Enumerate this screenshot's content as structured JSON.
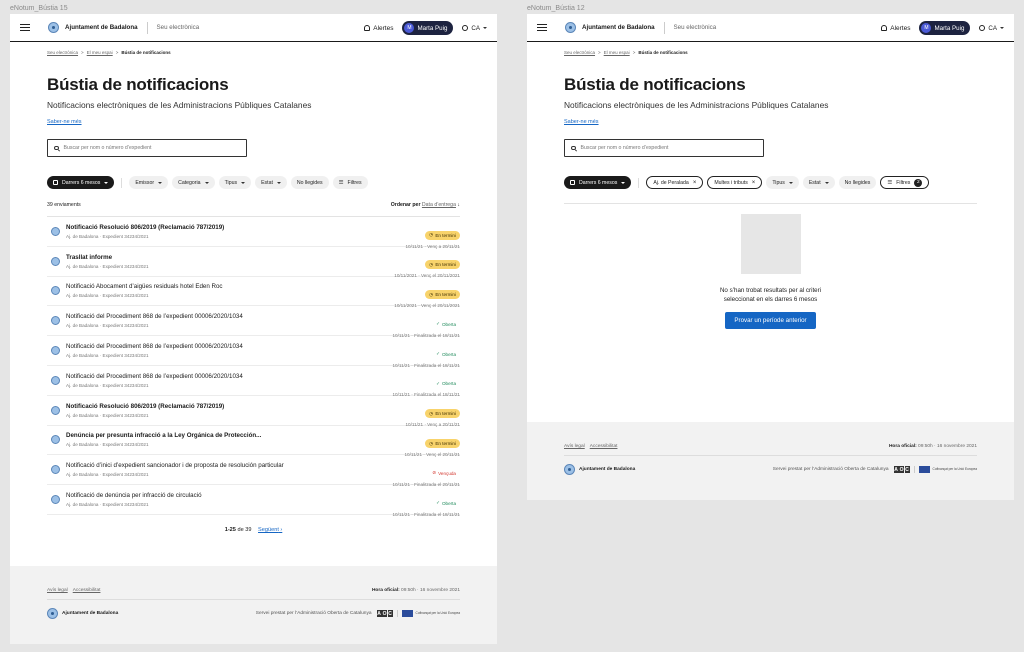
{
  "frames": [
    {
      "label": "eNotum_Bústia 15"
    },
    {
      "label": "eNotum_Bústia 12"
    }
  ],
  "header": {
    "org": "Ajuntament de Badalona",
    "sub": "Seu electrònica",
    "alerts": "Alertes",
    "user_initial": "M",
    "user_name": "Marta Puig",
    "lang": "CA"
  },
  "breadcrumb": {
    "items": [
      "Seu electrònica",
      "El meu espai"
    ],
    "current": "Bústia de notificacions",
    "sep": ">"
  },
  "page": {
    "title": "Bústia de notificacions",
    "subtitle": "Notificacions electròniques de les Administracions Públiques Catalanes",
    "more_link": "Saber-ne més"
  },
  "search": {
    "placeholder": "Buscar per nom o número d’expedient"
  },
  "filters_a": {
    "period": "Darrers 6 mesos",
    "emissor": "Emissor",
    "categoria": "Categoria",
    "tipus": "Tipus",
    "estat": "Estat",
    "unread": "No llegides",
    "filtres": "Filtres"
  },
  "filters_b": {
    "period": "Darrers 6 mesos",
    "chip1": "Aj. de Peralada",
    "chip2": "Multes i tributs",
    "tipus": "Tipus",
    "estat": "Estat",
    "unread": "No llegides",
    "filtres": "Filtres",
    "filtres_count": "2"
  },
  "list": {
    "count": "39 enviaments",
    "order_label": "Ordenar per",
    "order_value": "Data d’entrega",
    "items": [
      {
        "title": "Notificació Resolució 806/2019 (Reclamació 787/2019)",
        "sub": "Aj. de Badalona · Expedient 34234/2021",
        "status": "En termini",
        "kind": "term",
        "date": "10/11/21 · Venç a 20/11/21",
        "unread": true
      },
      {
        "title": "Trasllat informe",
        "sub": "Aj. de Badalona · Expedient 34234/2021",
        "status": "En termini",
        "kind": "term",
        "date": "10/11/2021 · Venç el 20/11/2021",
        "unread": true
      },
      {
        "title": "Notificació Abocament d’aigües residuals hotel Eden Roc",
        "sub": "Aj. de Badalona · Expedient 34234/2021",
        "status": "En termini",
        "kind": "term",
        "date": "10/11/2021 · Venç el 20/11/2021",
        "unread": false
      },
      {
        "title": "Notificació del Procediment 868 de l’expedient 00006/2020/1034",
        "sub": "Aj. de Badalona · Expedient 34234/2021",
        "status": "Oberta",
        "kind": "open",
        "date": "10/11/21 · Finalitzada el 18/11/21",
        "unread": false
      },
      {
        "title": "Notificació del Procediment 868 de l’expedient 00006/2020/1034",
        "sub": "Aj. de Badalona · Expedient 34234/2021",
        "status": "Oberta",
        "kind": "open",
        "date": "10/11/21 · Finalitzada el 18/11/21",
        "unread": false
      },
      {
        "title": "Notificació del Procediment 868 de l’expedient 00006/2020/1034",
        "sub": "Aj. de Badalona · Expedient 34234/2021",
        "status": "Oberta",
        "kind": "open",
        "date": "10/11/21 · Finalitzada el 18/11/21",
        "unread": false
      },
      {
        "title": "Notificació Resolució 806/2019 (Reclamació 787/2019)",
        "sub": "Aj. de Badalona · Expedient 34234/2021",
        "status": "En termini",
        "kind": "term",
        "date": "10/11/21 · Venç a 20/11/21",
        "unread": true
      },
      {
        "title": "Denúncia per presunta infracció a la Ley Orgánica de Protección...",
        "sub": "Aj. de Badalona · Expedient 34234/2021",
        "status": "En termini",
        "kind": "term",
        "date": "10/11/21 · Venç el 20/11/21",
        "unread": true
      },
      {
        "title": "Notificació d’inici d’expedient sancionador i de proposta de resolución particular",
        "sub": "Aj. de Badalona · Expedient 34234/2021",
        "status": "Vençuda",
        "kind": "late",
        "date": "10/11/21 · Finalitzada el 20/11/21",
        "unread": false
      },
      {
        "title": "Notificació de denúncia per infracció de circulació",
        "sub": "Aj. de Badalona · Expedient 34234/2021",
        "status": "Oberta",
        "kind": "open",
        "date": "10/11/21 · Finalitzada el 18/11/21",
        "unread": false
      }
    ]
  },
  "pager": {
    "range": "1-25",
    "of": "de 39",
    "next": "Següent"
  },
  "empty": {
    "line1": "No s’han trobat resultats per al criteri",
    "line2": "seleccionat en els darres 6 mesos",
    "button": "Provar un període anterior"
  },
  "footer": {
    "legal": "Avís legal",
    "access": "Accessibilitat",
    "time_label": "Hora oficial:",
    "time_value": "09:50h · 16 novembre 2021",
    "org": "Ajuntament de Badalona",
    "service": "Servei prestat per l’Administració Oberta de Catalunya",
    "eu": "Cofinançat per la Unió Europea"
  },
  "icons": {
    "check": "check-icon",
    "clock": "clock-icon",
    "ban": "ban-icon"
  }
}
